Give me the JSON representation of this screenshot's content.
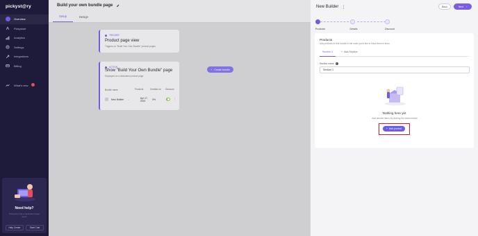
{
  "sidebar": {
    "logo": "pickyst@ry",
    "items": [
      {
        "label": "Overview",
        "icon": "overview-icon"
      },
      {
        "label": "Pickystart",
        "icon": "pickystart-icon"
      },
      {
        "label": "Analytics",
        "icon": "analytics-icon"
      },
      {
        "label": "Settings",
        "icon": "settings-icon"
      },
      {
        "label": "Integrations",
        "icon": "integrations-icon"
      },
      {
        "label": "Billing",
        "icon": "billing-icon"
      },
      {
        "label": "What's new",
        "icon": "whats-new-icon"
      }
    ],
    "help": {
      "title": "Need help?",
      "subtitle": "Pickystory has a dedicated setup team",
      "help_center": "Help Center",
      "start_chat": "Start Chat"
    }
  },
  "main": {
    "title": "Build your own bundle page",
    "tabs": [
      "Setup",
      "Design"
    ],
    "trigger_card": {
      "tag": "TRIGGER",
      "title": "Product page view",
      "subtitle": "Triggers on \"Build Your Own Bundle\" product pages"
    },
    "action_card": {
      "tag": "ACTION",
      "title": "Show \"Build Your Own Bundle\" page",
      "subtitle": "Displayed on a dedicated product page",
      "create_button": "Create bundle",
      "columns": [
        "Bundle name",
        "Products",
        "Created on",
        "Discount"
      ],
      "rows": [
        {
          "name": "New Builder",
          "products": "-",
          "created": "Apr 17, 2024",
          "discount": "0%"
        }
      ]
    }
  },
  "panel": {
    "title": "New Builder",
    "back": "Back",
    "next": "Next",
    "steps": [
      "Products",
      "Details",
      "Discount"
    ],
    "products": {
      "title": "Products",
      "subtitle": "Add products to this bundle in the order you'd like to show them in store.",
      "section_tab": "Section 1",
      "add_section": "Add Section",
      "section_name_label": "Section name",
      "section_name_value": "Section 1",
      "empty_title": "Nothing here yet",
      "empty_sub": "Add desired items by clicking the button below",
      "add_product": "Add product"
    }
  },
  "colors": {
    "accent": "#6c5ce7",
    "sidebar_bg": "#1e1b3a",
    "highlight": "#e0142b"
  }
}
